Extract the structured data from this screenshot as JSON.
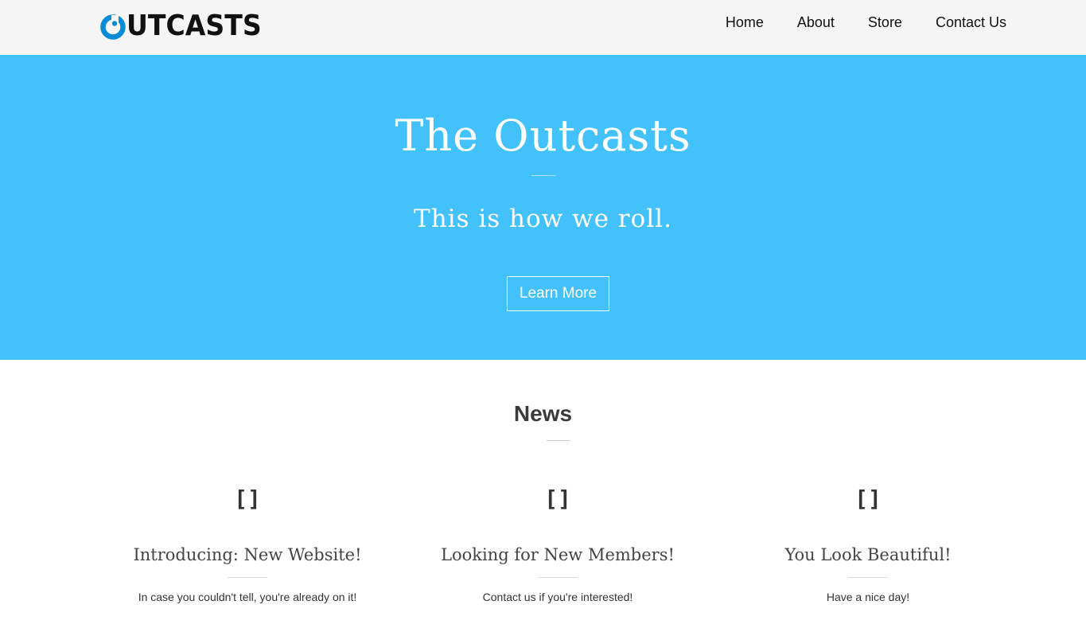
{
  "header": {
    "logo_text": "UTCASTS",
    "logo_color": "#0a8bd6",
    "nav": [
      "Home",
      "About",
      "Store",
      "Contact Us"
    ]
  },
  "hero": {
    "title": "The Outcasts",
    "subtitle": "This is how we roll.",
    "button_label": "Learn More",
    "background": "#42c1fb"
  },
  "news": {
    "title": "News",
    "items": [
      {
        "icon": "[]",
        "title": "Introducing: New Website!",
        "text": "In case you couldn't tell, you're already on it!"
      },
      {
        "icon": "[]",
        "title": "Looking for New Members!",
        "text": "Contact us if you're interested!"
      },
      {
        "icon": "[]",
        "title": "You Look Beautiful!",
        "text": "Have a nice day!"
      }
    ]
  }
}
